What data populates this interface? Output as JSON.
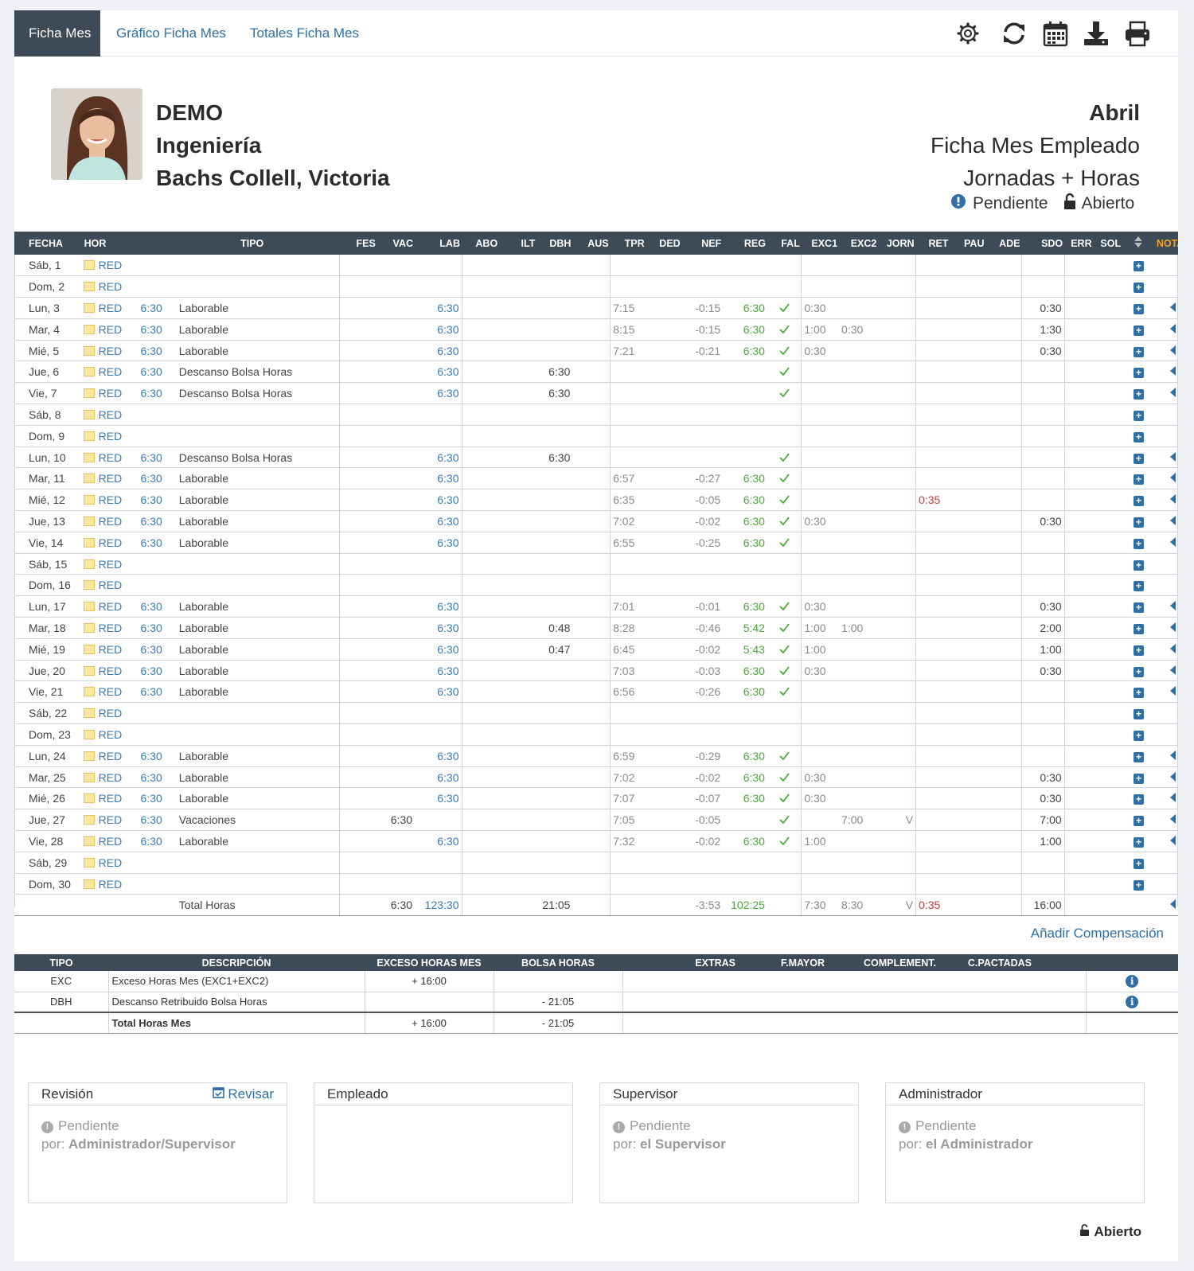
{
  "tabs": [
    {
      "label": "Ficha Mes"
    },
    {
      "label": "Gráfico Ficha Mes"
    },
    {
      "label": "Totales Ficha Mes"
    }
  ],
  "header": {
    "company": "DEMO",
    "department": "Ingeniería",
    "employee": "Bachs Collell, Victoria",
    "month": "Abril",
    "title": "Ficha Mes Empleado",
    "subtitle": "Jornadas + Horas",
    "status_pending": "Pendiente",
    "status_open": "Abierto"
  },
  "table": {
    "headers": [
      "FECHA",
      "HOR",
      "TIPO",
      "FES",
      "VAC",
      "LAB",
      "ABO",
      "ILT",
      "DBH",
      "AUS",
      "TPR",
      "DED",
      "NEF",
      "REG",
      "FAL",
      "EXC1",
      "EXC2",
      "JORN",
      "RET",
      "PAU",
      "ADE",
      "SDO",
      "ERR",
      "SOL",
      "NOTAS"
    ],
    "rows": [
      {
        "fecha": "Sáb, 1",
        "hor": "RED",
        "horas": "",
        "tipo": "",
        "vac": "",
        "lab": "",
        "dbh": "",
        "tpr": "",
        "nef": "",
        "reg": "",
        "fal": false,
        "exc1": "",
        "exc2": "",
        "jorn": "",
        "ret": "",
        "sdo": "",
        "arrow": false
      },
      {
        "fecha": "Dom, 2",
        "hor": "RED",
        "horas": "",
        "tipo": "",
        "vac": "",
        "lab": "",
        "dbh": "",
        "tpr": "",
        "nef": "",
        "reg": "",
        "fal": false,
        "exc1": "",
        "exc2": "",
        "jorn": "",
        "ret": "",
        "sdo": "",
        "arrow": false
      },
      {
        "fecha": "Lun, 3",
        "hor": "RED",
        "horas": "6:30",
        "tipo": "Laborable",
        "vac": "",
        "lab": "6:30",
        "dbh": "",
        "tpr": "7:15",
        "nef": "-0:15",
        "reg": "6:30",
        "fal": true,
        "exc1": "0:30",
        "exc2": "",
        "jorn": "",
        "ret": "",
        "sdo": "0:30",
        "arrow": true
      },
      {
        "fecha": "Mar, 4",
        "hor": "RED",
        "horas": "6:30",
        "tipo": "Laborable",
        "vac": "",
        "lab": "6:30",
        "dbh": "",
        "tpr": "8:15",
        "nef": "-0:15",
        "reg": "6:30",
        "fal": true,
        "exc1": "1:00",
        "exc2": "0:30",
        "jorn": "",
        "ret": "",
        "sdo": "1:30",
        "arrow": true
      },
      {
        "fecha": "Mié, 5",
        "hor": "RED",
        "horas": "6:30",
        "tipo": "Laborable",
        "vac": "",
        "lab": "6:30",
        "dbh": "",
        "tpr": "7:21",
        "nef": "-0:21",
        "reg": "6:30",
        "fal": true,
        "exc1": "0:30",
        "exc2": "",
        "jorn": "",
        "ret": "",
        "sdo": "0:30",
        "arrow": true
      },
      {
        "fecha": "Jue, 6",
        "hor": "RED",
        "horas": "6:30",
        "tipo": "Descanso Bolsa Horas",
        "vac": "",
        "lab": "6:30",
        "dbh": "6:30",
        "tpr": "",
        "nef": "",
        "reg": "",
        "fal": true,
        "exc1": "",
        "exc2": "",
        "jorn": "",
        "ret": "",
        "sdo": "",
        "arrow": true
      },
      {
        "fecha": "Vie, 7",
        "hor": "RED",
        "horas": "6:30",
        "tipo": "Descanso Bolsa Horas",
        "vac": "",
        "lab": "6:30",
        "dbh": "6:30",
        "tpr": "",
        "nef": "",
        "reg": "",
        "fal": true,
        "exc1": "",
        "exc2": "",
        "jorn": "",
        "ret": "",
        "sdo": "",
        "arrow": true
      },
      {
        "fecha": "Sáb, 8",
        "hor": "RED",
        "horas": "",
        "tipo": "",
        "vac": "",
        "lab": "",
        "dbh": "",
        "tpr": "",
        "nef": "",
        "reg": "",
        "fal": false,
        "exc1": "",
        "exc2": "",
        "jorn": "",
        "ret": "",
        "sdo": "",
        "arrow": false
      },
      {
        "fecha": "Dom, 9",
        "hor": "RED",
        "horas": "",
        "tipo": "",
        "vac": "",
        "lab": "",
        "dbh": "",
        "tpr": "",
        "nef": "",
        "reg": "",
        "fal": false,
        "exc1": "",
        "exc2": "",
        "jorn": "",
        "ret": "",
        "sdo": "",
        "arrow": false
      },
      {
        "fecha": "Lun, 10",
        "hor": "RED",
        "horas": "6:30",
        "tipo": "Descanso Bolsa Horas",
        "vac": "",
        "lab": "6:30",
        "dbh": "6:30",
        "tpr": "",
        "nef": "",
        "reg": "",
        "fal": true,
        "exc1": "",
        "exc2": "",
        "jorn": "",
        "ret": "",
        "sdo": "",
        "arrow": true
      },
      {
        "fecha": "Mar, 11",
        "hor": "RED",
        "horas": "6:30",
        "tipo": "Laborable",
        "vac": "",
        "lab": "6:30",
        "dbh": "",
        "tpr": "6:57",
        "nef": "-0:27",
        "reg": "6:30",
        "fal": true,
        "exc1": "",
        "exc2": "",
        "jorn": "",
        "ret": "",
        "sdo": "",
        "arrow": true
      },
      {
        "fecha": "Mié, 12",
        "hor": "RED",
        "horas": "6:30",
        "tipo": "Laborable",
        "vac": "",
        "lab": "6:30",
        "dbh": "",
        "tpr": "6:35",
        "nef": "-0:05",
        "reg": "6:30",
        "fal": true,
        "exc1": "",
        "exc2": "",
        "jorn": "",
        "ret": "0:35",
        "sdo": "",
        "arrow": true
      },
      {
        "fecha": "Jue, 13",
        "hor": "RED",
        "horas": "6:30",
        "tipo": "Laborable",
        "vac": "",
        "lab": "6:30",
        "dbh": "",
        "tpr": "7:02",
        "nef": "-0:02",
        "reg": "6:30",
        "fal": true,
        "exc1": "0:30",
        "exc2": "",
        "jorn": "",
        "ret": "",
        "sdo": "0:30",
        "arrow": true
      },
      {
        "fecha": "Vie, 14",
        "hor": "RED",
        "horas": "6:30",
        "tipo": "Laborable",
        "vac": "",
        "lab": "6:30",
        "dbh": "",
        "tpr": "6:55",
        "nef": "-0:25",
        "reg": "6:30",
        "fal": true,
        "exc1": "",
        "exc2": "",
        "jorn": "",
        "ret": "",
        "sdo": "",
        "arrow": true
      },
      {
        "fecha": "Sáb, 15",
        "hor": "RED",
        "horas": "",
        "tipo": "",
        "vac": "",
        "lab": "",
        "dbh": "",
        "tpr": "",
        "nef": "",
        "reg": "",
        "fal": false,
        "exc1": "",
        "exc2": "",
        "jorn": "",
        "ret": "",
        "sdo": "",
        "arrow": false
      },
      {
        "fecha": "Dom, 16",
        "hor": "RED",
        "horas": "",
        "tipo": "",
        "vac": "",
        "lab": "",
        "dbh": "",
        "tpr": "",
        "nef": "",
        "reg": "",
        "fal": false,
        "exc1": "",
        "exc2": "",
        "jorn": "",
        "ret": "",
        "sdo": "",
        "arrow": false
      },
      {
        "fecha": "Lun, 17",
        "hor": "RED",
        "horas": "6:30",
        "tipo": "Laborable",
        "vac": "",
        "lab": "6:30",
        "dbh": "",
        "tpr": "7:01",
        "nef": "-0:01",
        "reg": "6:30",
        "fal": true,
        "exc1": "0:30",
        "exc2": "",
        "jorn": "",
        "ret": "",
        "sdo": "0:30",
        "arrow": true
      },
      {
        "fecha": "Mar, 18",
        "hor": "RED",
        "horas": "6:30",
        "tipo": "Laborable",
        "vac": "",
        "lab": "6:30",
        "dbh": "0:48",
        "tpr": "8:28",
        "nef": "-0:46",
        "reg": "5:42",
        "fal": true,
        "exc1": "1:00",
        "exc2": "1:00",
        "jorn": "",
        "ret": "",
        "sdo": "2:00",
        "arrow": true
      },
      {
        "fecha": "Mié, 19",
        "hor": "RED",
        "horas": "6:30",
        "tipo": "Laborable",
        "vac": "",
        "lab": "6:30",
        "dbh": "0:47",
        "tpr": "6:45",
        "nef": "-0:02",
        "reg": "5:43",
        "fal": true,
        "exc1": "1:00",
        "exc2": "",
        "jorn": "",
        "ret": "",
        "sdo": "1:00",
        "arrow": true
      },
      {
        "fecha": "Jue, 20",
        "hor": "RED",
        "horas": "6:30",
        "tipo": "Laborable",
        "vac": "",
        "lab": "6:30",
        "dbh": "",
        "tpr": "7:03",
        "nef": "-0:03",
        "reg": "6:30",
        "fal": true,
        "exc1": "0:30",
        "exc2": "",
        "jorn": "",
        "ret": "",
        "sdo": "0:30",
        "arrow": true
      },
      {
        "fecha": "Vie, 21",
        "hor": "RED",
        "horas": "6:30",
        "tipo": "Laborable",
        "vac": "",
        "lab": "6:30",
        "dbh": "",
        "tpr": "6:56",
        "nef": "-0:26",
        "reg": "6:30",
        "fal": true,
        "exc1": "",
        "exc2": "",
        "jorn": "",
        "ret": "",
        "sdo": "",
        "arrow": true
      },
      {
        "fecha": "Sáb, 22",
        "hor": "RED",
        "horas": "",
        "tipo": "",
        "vac": "",
        "lab": "",
        "dbh": "",
        "tpr": "",
        "nef": "",
        "reg": "",
        "fal": false,
        "exc1": "",
        "exc2": "",
        "jorn": "",
        "ret": "",
        "sdo": "",
        "arrow": false
      },
      {
        "fecha": "Dom, 23",
        "hor": "RED",
        "horas": "",
        "tipo": "",
        "vac": "",
        "lab": "",
        "dbh": "",
        "tpr": "",
        "nef": "",
        "reg": "",
        "fal": false,
        "exc1": "",
        "exc2": "",
        "jorn": "",
        "ret": "",
        "sdo": "",
        "arrow": false
      },
      {
        "fecha": "Lun, 24",
        "hor": "RED",
        "horas": "6:30",
        "tipo": "Laborable",
        "vac": "",
        "lab": "6:30",
        "dbh": "",
        "tpr": "6:59",
        "nef": "-0:29",
        "reg": "6:30",
        "fal": true,
        "exc1": "",
        "exc2": "",
        "jorn": "",
        "ret": "",
        "sdo": "",
        "arrow": true
      },
      {
        "fecha": "Mar, 25",
        "hor": "RED",
        "horas": "6:30",
        "tipo": "Laborable",
        "vac": "",
        "lab": "6:30",
        "dbh": "",
        "tpr": "7:02",
        "nef": "-0:02",
        "reg": "6:30",
        "fal": true,
        "exc1": "0:30",
        "exc2": "",
        "jorn": "",
        "ret": "",
        "sdo": "0:30",
        "arrow": true
      },
      {
        "fecha": "Mié, 26",
        "hor": "RED",
        "horas": "6:30",
        "tipo": "Laborable",
        "vac": "",
        "lab": "6:30",
        "dbh": "",
        "tpr": "7:07",
        "nef": "-0:07",
        "reg": "6:30",
        "fal": true,
        "exc1": "0:30",
        "exc2": "",
        "jorn": "",
        "ret": "",
        "sdo": "0:30",
        "arrow": true
      },
      {
        "fecha": "Jue, 27",
        "hor": "RED",
        "horas": "6:30",
        "tipo": "Vacaciones",
        "vac": "6:30",
        "lab": "",
        "dbh": "",
        "tpr": "7:05",
        "nef": "-0:05",
        "reg": "",
        "fal": true,
        "exc1": "",
        "exc2": "7:00",
        "jorn": "V",
        "ret": "",
        "sdo": "7:00",
        "arrow": true
      },
      {
        "fecha": "Vie, 28",
        "hor": "RED",
        "horas": "6:30",
        "tipo": "Laborable",
        "vac": "",
        "lab": "6:30",
        "dbh": "",
        "tpr": "7:32",
        "nef": "-0:02",
        "reg": "6:30",
        "fal": true,
        "exc1": "1:00",
        "exc2": "",
        "jorn": "",
        "ret": "",
        "sdo": "1:00",
        "arrow": true
      },
      {
        "fecha": "Sáb, 29",
        "hor": "RED",
        "horas": "",
        "tipo": "",
        "vac": "",
        "lab": "",
        "dbh": "",
        "tpr": "",
        "nef": "",
        "reg": "",
        "fal": false,
        "exc1": "",
        "exc2": "",
        "jorn": "",
        "ret": "",
        "sdo": "",
        "arrow": false
      },
      {
        "fecha": "Dom, 30",
        "hor": "RED",
        "horas": "",
        "tipo": "",
        "vac": "",
        "lab": "",
        "dbh": "",
        "tpr": "",
        "nef": "",
        "reg": "",
        "fal": false,
        "exc1": "",
        "exc2": "",
        "jorn": "",
        "ret": "",
        "sdo": "",
        "arrow": false
      }
    ],
    "totals": {
      "label": "Total Horas",
      "vac": "6:30",
      "lab": "123:30",
      "dbh": "21:05",
      "nef": "-3:53",
      "reg": "102:25",
      "exc1": "7:30",
      "exc2": "8:30",
      "jorn": "V",
      "ret": "0:35",
      "sdo": "16:00"
    }
  },
  "add_compensation": "Añadir Compensación",
  "summary": {
    "headers": [
      "TIPO",
      "DESCRIPCIÓN",
      "EXCESO HORAS MES",
      "BOLSA HORAS",
      "EXTRAS",
      "F.MAYOR",
      "COMPLEMENT.",
      "C.PACTADAS"
    ],
    "rows": [
      {
        "tipo": "EXC",
        "desc": "Exceso Horas Mes (EXC1+EXC2)",
        "exceso": "+ 16:00",
        "bolsa": ""
      },
      {
        "tipo": "DBH",
        "desc": "Descanso Retribuido Bolsa Horas",
        "exceso": "",
        "bolsa": "- 21:05"
      }
    ],
    "total": {
      "label": "Total Horas Mes",
      "exceso": "+ 16:00",
      "bolsa": "- 21:05"
    }
  },
  "boxes": {
    "revision": {
      "title": "Revisión",
      "action": "Revisar",
      "status": "Pendiente",
      "by_label": "por:",
      "by": "Administrador/Supervisor"
    },
    "empleado": {
      "title": "Empleado"
    },
    "supervisor": {
      "title": "Supervisor",
      "status": "Pendiente",
      "by_label": "por:",
      "by": "el Supervisor"
    },
    "administrador": {
      "title": "Administrador",
      "status": "Pendiente",
      "by_label": "por:",
      "by": "el Administrador"
    }
  },
  "footer_status": "Abierto",
  "colors": {
    "header_bg": "#3d4a58",
    "link": "#2f6fa5",
    "green": "#4ca839",
    "red": "#c63b3b",
    "notas": "#f5a623"
  }
}
